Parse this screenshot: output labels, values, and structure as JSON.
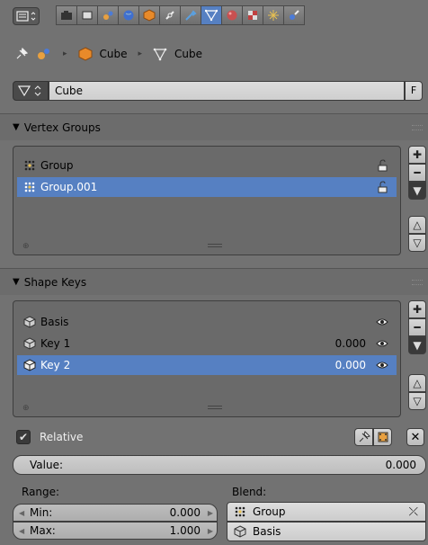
{
  "breadcrumb": {
    "object_name": "Cube",
    "data_name": "Cube"
  },
  "id_block": {
    "name": "Cube",
    "fake_user": "F"
  },
  "vertex_groups": {
    "title": "Vertex Groups",
    "items": [
      {
        "label": "Group",
        "selected": false
      },
      {
        "label": "Group.001",
        "selected": true
      }
    ]
  },
  "shape_keys": {
    "title": "Shape Keys",
    "items": [
      {
        "label": "Basis",
        "value": "",
        "selected": false
      },
      {
        "label": "Key 1",
        "value": "0.000",
        "selected": false
      },
      {
        "label": "Key 2",
        "value": "0.000",
        "selected": true
      }
    ],
    "relative_label": "Relative",
    "value_label": "Value:",
    "value": "0.000",
    "range_label": "Range:",
    "min_label": "Min:",
    "min_value": "0.000",
    "max_label": "Max:",
    "max_value": "1.000",
    "blend_label": "Blend:",
    "blend_group": "Group",
    "blend_basis": "Basis"
  },
  "colors": {
    "selection": "#5680c2",
    "panel_bg": "#727272"
  }
}
